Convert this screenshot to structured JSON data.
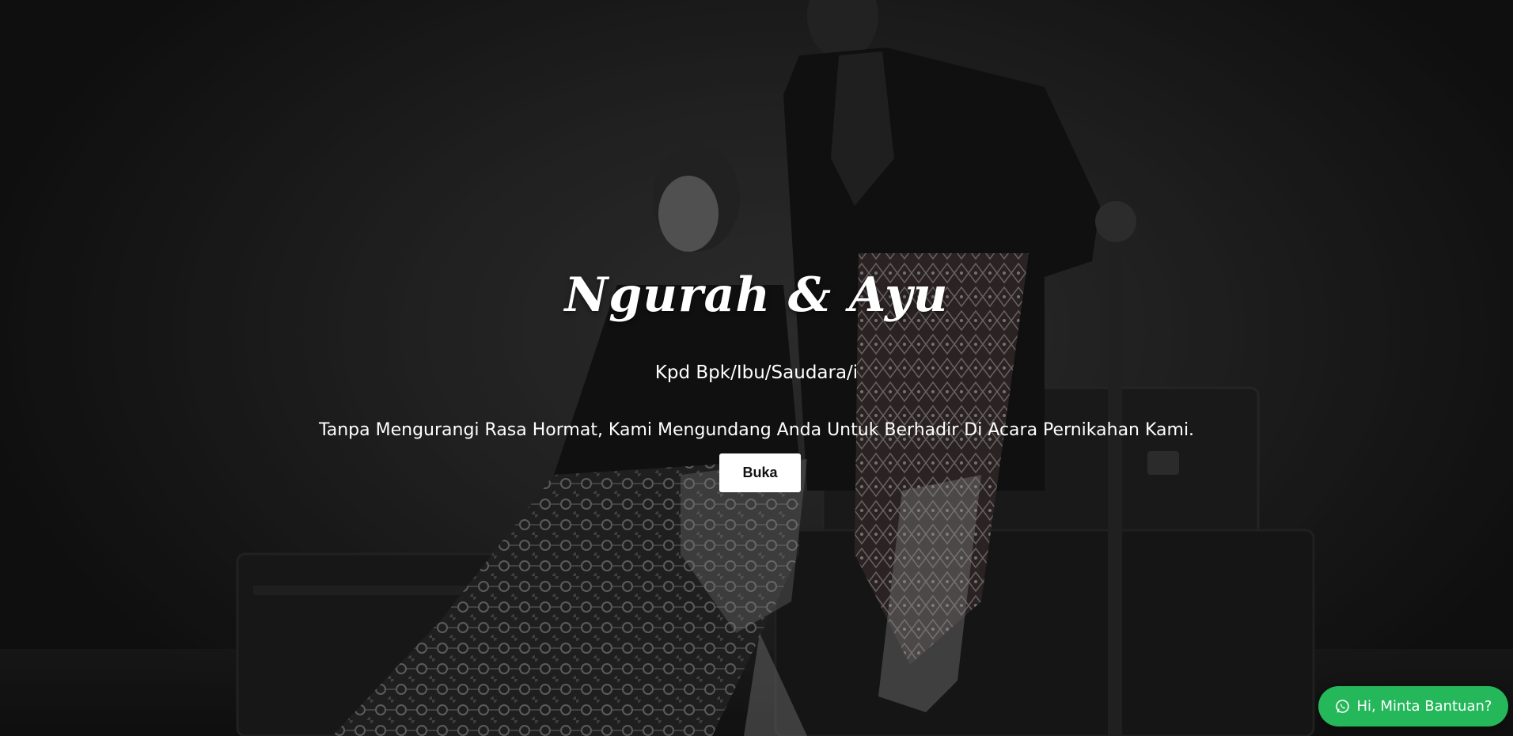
{
  "hero": {
    "couple_name": "Ngurah & Ayu",
    "recipient_line": "Kpd Bpk/Ibu/Saudara/i",
    "invitation_text": "Tanpa Mengurangi Rasa Hormat, Kami Mengundang Anda Untuk Berhadir Di Acara Pernikahan Kami.",
    "open_button_label": "Buka"
  },
  "help_widget": {
    "label": "Hi, Minta Bantuan?",
    "icon": "whatsapp-icon",
    "color": "#25b85a"
  }
}
